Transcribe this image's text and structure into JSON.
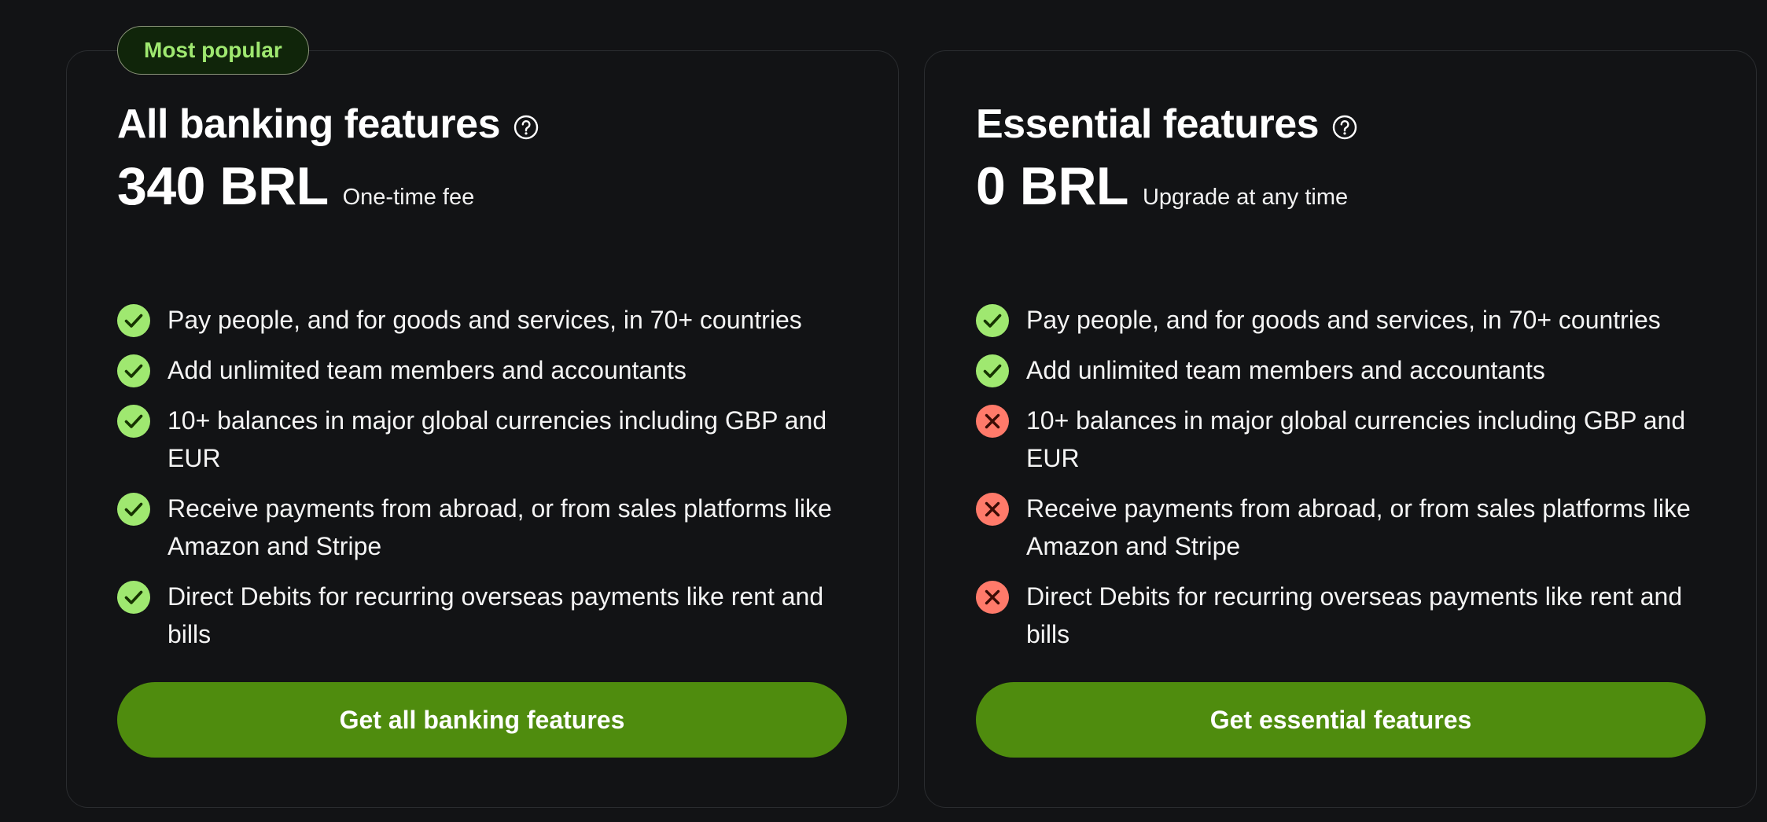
{
  "plans": [
    {
      "badge": "Most popular",
      "title": "All banking features",
      "price": "340 BRL",
      "price_note": "One-time fee",
      "features": [
        {
          "text": "Pay people, and for goods and services, in 70+ countries",
          "icon": "check-icon"
        },
        {
          "text": "Add unlimited team members and accountants",
          "icon": "check-icon"
        },
        {
          "text": "10+ balances in major global currencies including GBP and EUR",
          "icon": "check-icon"
        },
        {
          "text": "Receive payments from abroad, or from sales platforms like Amazon and Stripe",
          "icon": "check-icon"
        },
        {
          "text": "Direct Debits for recurring overseas payments like rent and bills",
          "icon": "check-icon"
        }
      ],
      "cta": "Get all banking features"
    },
    {
      "title": "Essential features",
      "price": "0 BRL",
      "price_note": "Upgrade at any time",
      "features": [
        {
          "text": "Pay people, and for goods and services, in 70+ countries",
          "icon": "check-icon"
        },
        {
          "text": "Add unlimited team members and accountants",
          "icon": "check-icon"
        },
        {
          "text": "10+ balances in major global currencies including GBP and EUR",
          "icon": "cross-icon"
        },
        {
          "text": "Receive payments from abroad, or from sales platforms like Amazon and Stripe",
          "icon": "cross-icon"
        },
        {
          "text": "Direct Debits for recurring overseas payments like rent and bills",
          "icon": "cross-icon"
        }
      ],
      "cta": "Get essential features"
    }
  ],
  "colors": {
    "background": "#121315",
    "card_border": "#2a2c2f",
    "accent_green": "#9fe870",
    "button_green": "#4f8c0e",
    "cross_red": "#ff7a6a"
  }
}
